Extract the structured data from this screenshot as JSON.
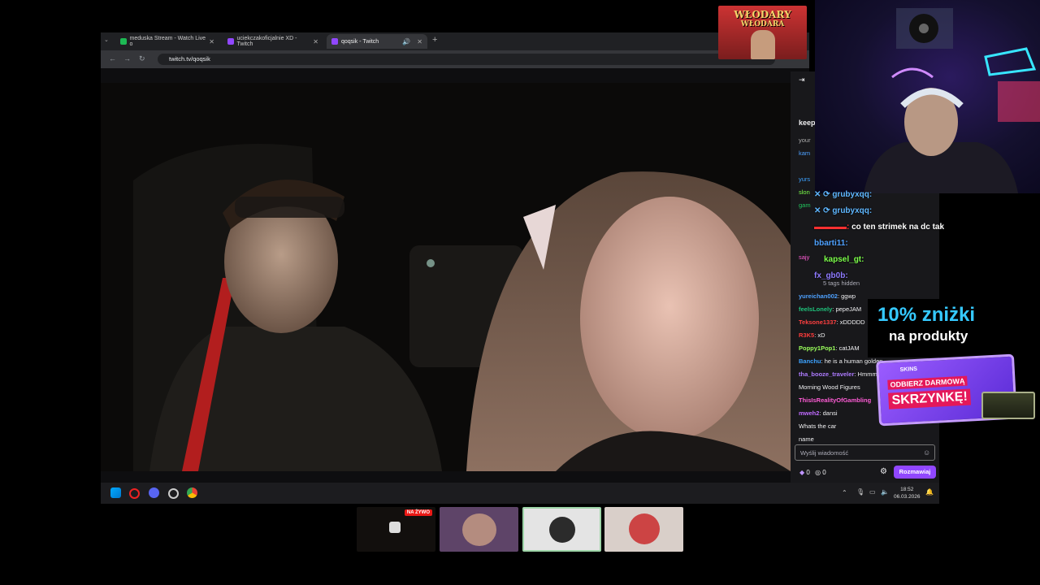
{
  "browser": {
    "tabs": [
      {
        "title": "meduska Stream - Watch Live o",
        "color": "#1db954",
        "active": false
      },
      {
        "title": "uciekczakoficjalnie XD - Twitch",
        "color": "#9147ff",
        "active": false
      },
      {
        "title": "qoqsik - Twitch",
        "color": "#9147ff",
        "active": true
      }
    ],
    "url": "twitch.tv/qoqsik"
  },
  "chat": {
    "messages": [
      {
        "user": "yureichan002",
        "text": "ggwp",
        "color": "#4ea1ff"
      },
      {
        "user": "feelsLonely",
        "text": "pepeJAM",
        "color": "#1fc47c"
      },
      {
        "user": "Teksone1337",
        "text": "xDDDDD",
        "color": "#ff4040"
      },
      {
        "user": "R3K5",
        "text": "xD",
        "color": "#ff3b3b"
      },
      {
        "user": "Poppy1Pop1",
        "text": "catJAM",
        "color": "#9aff5b"
      },
      {
        "user": "Banchu",
        "text": "he is a human golden",
        "color": "#3ca2ff"
      },
      {
        "user": "tha_booze_traveler",
        "text": "Hmmm",
        "color": "#ae7bff"
      },
      {
        "user": "",
        "text": "Morning Wood Figures",
        "color": "#efeff1"
      },
      {
        "user": "ThisIsRealityOfGambling",
        "text": "",
        "color": "#ff5cd6"
      },
      {
        "user": "mweh2",
        "text": "dansi",
        "color": "#c06bff"
      },
      {
        "user": "",
        "text": "Whats the car",
        "color": "#efeff1"
      },
      {
        "user": "",
        "text": "name",
        "color": "#efeff1"
      }
    ],
    "partial": [
      "keep",
      "your",
      "kam",
      "yurs",
      "slon",
      "gam",
      "sajy"
    ],
    "input_placeholder": "Wyślij wiadomość",
    "points_a": "0",
    "points_b": "0",
    "chat_button": "Rozmawiaj",
    "hidden_note": "5 tags hidden"
  },
  "taskbar": {
    "time": "18:52",
    "date": "06.03.2026"
  },
  "overlay_chat": [
    {
      "user": "grubyxqq",
      "text": "",
      "color": "#5fb7ff"
    },
    {
      "user": "grubyxqq",
      "text": "",
      "color": "#5fb7ff"
    },
    {
      "user": "",
      "text": "co ten strimek na dc tak",
      "color": "#ff3030"
    },
    {
      "user": "bbarti11",
      "text": "",
      "color": "#4ea1ff"
    },
    {
      "user": "kapsel_gt",
      "text": "",
      "color": "#7cff4a"
    },
    {
      "user": "fx_gb0b",
      "text": "",
      "color": "#8f7bff"
    }
  ],
  "badge": {
    "title": "WŁODARY",
    "subtitle": "WŁODARA"
  },
  "promo": {
    "headline": "10% zniżki",
    "subline": "na produkty",
    "brand": "SKINS",
    "cta1": "ODBIERZ DARMOWĄ",
    "cta2": "SKRZYNKĘ!"
  },
  "live_badge": "NA ŻYWO"
}
